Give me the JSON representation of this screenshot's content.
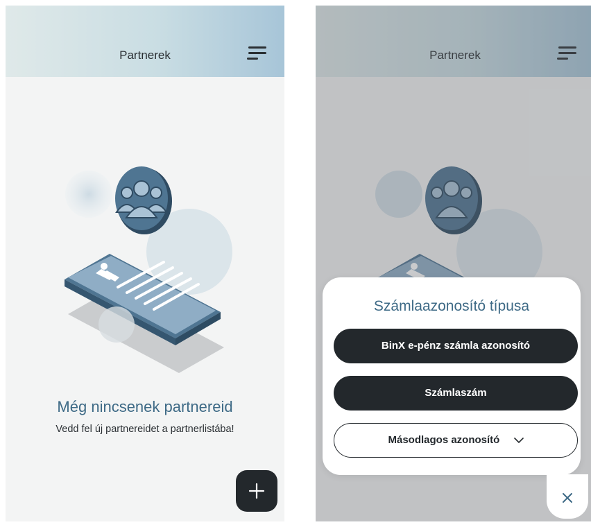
{
  "left_screen": {
    "header": {
      "title": "Partnerek"
    },
    "empty_state": {
      "title": "Még nincsenek partnereid",
      "subtitle": "Vedd fel új partnereidet a partnerlistába!"
    },
    "fab": {
      "icon": "plus-icon"
    }
  },
  "right_screen": {
    "header": {
      "title": "Partnerek"
    },
    "sheet": {
      "title": "Számlaazonosító típusa",
      "options": [
        {
          "label": "BinX e-pénz számla azonosító",
          "style": "filled"
        },
        {
          "label": "Számlaszám",
          "style": "filled"
        },
        {
          "label": "Másodlagos azonosító",
          "style": "outlined",
          "icon": "chevron-down-icon"
        }
      ],
      "close_icon": "close-icon"
    }
  },
  "colors": {
    "accent": "#3e6a86",
    "dark_button": "#23282c",
    "background": "#f3f4f4"
  }
}
